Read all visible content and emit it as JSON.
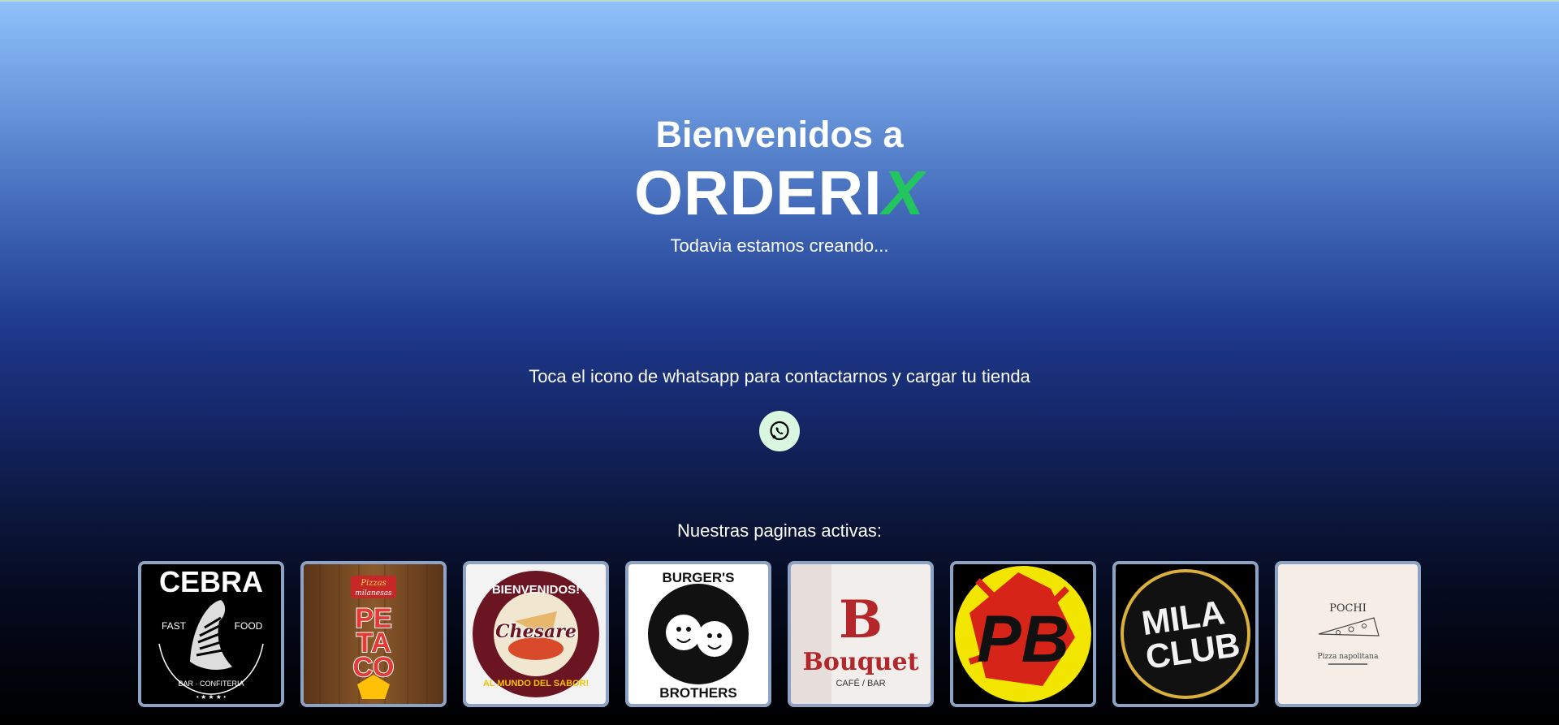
{
  "hero": {
    "welcome": "Bienvenidos a",
    "brand_main": "ORDERI",
    "brand_accent": "X",
    "subtitle": "Todavia estamos creando..."
  },
  "contact": {
    "text": "Toca el icono de whatsapp para contactarnos y cargar tu tienda",
    "icon": "whatsapp-icon"
  },
  "stores": {
    "title": "Nuestras paginas activas:",
    "items": [
      {
        "name": "CEBRA",
        "line1": "FAST",
        "line2": "FOOD",
        "line3": "BAR · CONFITERIA"
      },
      {
        "name": "PETACO",
        "line1": "Pizzas",
        "line2": "milanesas"
      },
      {
        "name": "Chesare",
        "line1": "BIENVENIDOS!",
        "line2": "AL MUNDO DEL SABOR!"
      },
      {
        "name": "BURGER'S",
        "line1": "BROTHERS"
      },
      {
        "name": "Bouquet",
        "line1": "B",
        "line2": "CAFÉ / BAR"
      },
      {
        "name": "PB"
      },
      {
        "name": "MILA",
        "line1": "CLUB"
      },
      {
        "name": "POCHI",
        "line1": "Pizza napolitana"
      }
    ]
  },
  "colors": {
    "accent_green": "#22c55e",
    "whatsapp_bg": "#d8f7de",
    "card_border": "#8ea3c4"
  }
}
